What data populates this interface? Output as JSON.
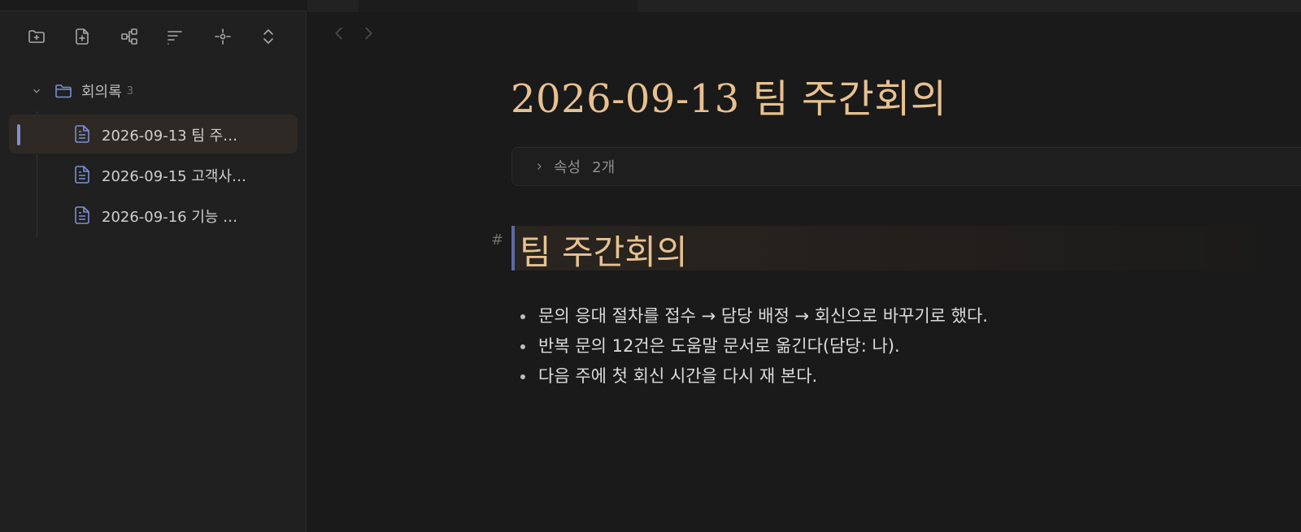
{
  "sidebar": {
    "toolbar": [
      {
        "name": "new-folder-icon"
      },
      {
        "name": "new-note-icon"
      },
      {
        "name": "graph-icon"
      },
      {
        "name": "sort-icon"
      },
      {
        "name": "locate-icon"
      },
      {
        "name": "expand-collapse-icon"
      }
    ],
    "folder": {
      "name": "회의록",
      "count": "3",
      "icon": "folder-icon",
      "expanded": true
    },
    "files": [
      {
        "label": "2026-09-13 팀 주…",
        "active": true,
        "icon": "document-icon"
      },
      {
        "label": "2026-09-15 고객사…",
        "active": false,
        "icon": "document-icon"
      },
      {
        "label": "2026-09-16 기능 …",
        "active": false,
        "icon": "document-icon"
      }
    ]
  },
  "main": {
    "nav": {
      "back": "chevron-left-icon",
      "forward": "chevron-right-icon"
    },
    "title": "2026-09-13 팀 주간회의",
    "properties": {
      "label": "속성",
      "count": "2개"
    },
    "heading": {
      "marker": "#",
      "text": "팀 주간회의"
    },
    "bullets": [
      "문의 응대 절차를 접수 → 담당 배정 → 회신으로 바꾸기로 했다.",
      "반복 문의 12건은 도움말 문서로 옮긴다(담당: 나).",
      "다음 주에 첫 회신 시간을 다시 재 본다."
    ]
  },
  "colors": {
    "accent": "#7d8fd4",
    "title": "#e8c190",
    "background": "#1a1a1a",
    "sidebar": "#202020"
  }
}
